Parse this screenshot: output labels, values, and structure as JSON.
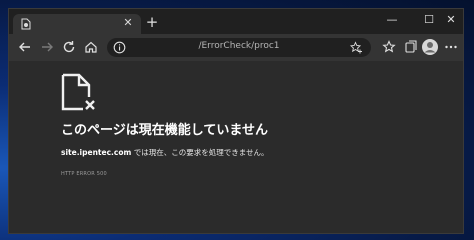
{
  "tab": {
    "close_glyph": "✕"
  },
  "titlebar": {
    "new_tab_glyph": "+",
    "minimize_glyph": "—",
    "maximize_glyph": "☐",
    "close_glyph": "✕"
  },
  "toolbar": {
    "address": "/ErrorCheck/proc1"
  },
  "error": {
    "heading": "このページは現在機能していません",
    "site": "site.ipentec.com",
    "message": " では現在、この要求を処理できません。",
    "code": "HTTP ERROR 500"
  }
}
